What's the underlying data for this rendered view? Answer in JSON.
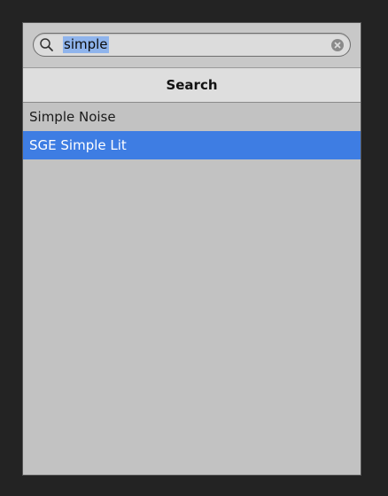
{
  "search": {
    "query": "simple",
    "icon": "search-icon",
    "clear_icon": "clear-icon"
  },
  "header": {
    "title": "Search"
  },
  "results": [
    {
      "label": "Simple Noise",
      "selected": false
    },
    {
      "label": "SGE Simple Lit",
      "selected": true
    }
  ],
  "colors": {
    "selection": "#3e7de3",
    "panel": "#c2c2c2",
    "background": "#232323"
  }
}
